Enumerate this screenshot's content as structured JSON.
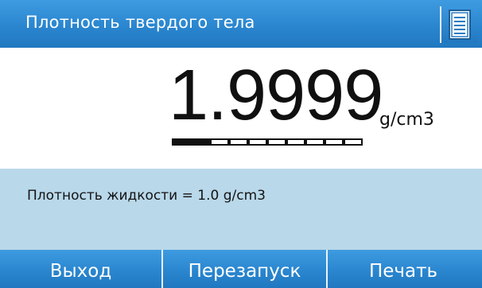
{
  "header": {
    "title": "Плотность твердого тела",
    "menu_icon": "document-list-icon"
  },
  "readout": {
    "value": "1.9999",
    "unit": "g/cm3",
    "stability_segments_filled": 2,
    "stability_segments_total": 10
  },
  "info": {
    "liquid_density_text": "Плотность жидкости = 1.0 g/cm3"
  },
  "footer": {
    "exit_label": "Выход",
    "restart_label": "Перезапуск",
    "print_label": "Печать"
  },
  "colors": {
    "header_blue": "#2a86cf",
    "info_panel": "#b9d8ea",
    "text_dark": "#111111"
  }
}
